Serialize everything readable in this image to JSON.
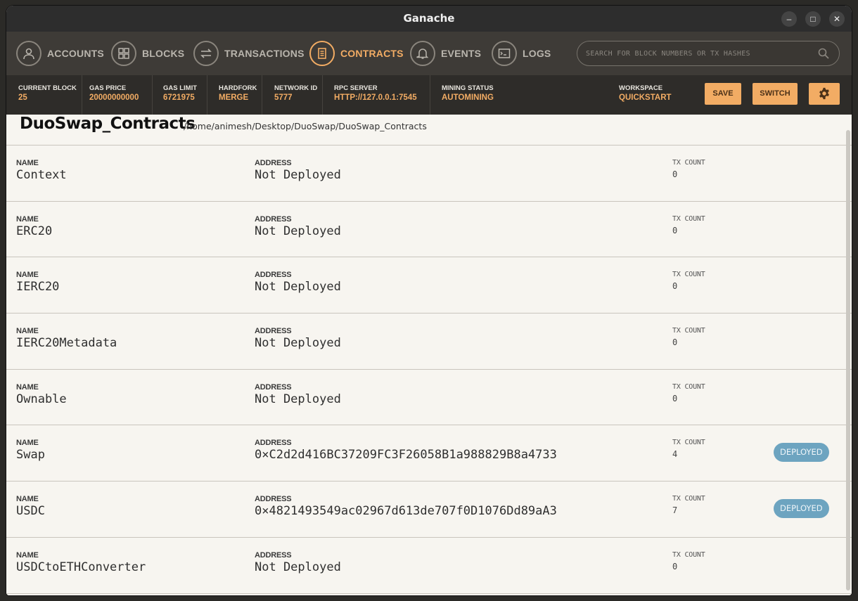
{
  "window": {
    "title": "Ganache"
  },
  "nav": {
    "items": [
      {
        "label": "ACCOUNTS",
        "icon": "account-icon"
      },
      {
        "label": "BLOCKS",
        "icon": "blocks-icon"
      },
      {
        "label": "TRANSACTIONS",
        "icon": "transactions-icon"
      },
      {
        "label": "CONTRACTS",
        "icon": "contracts-icon",
        "active": true
      },
      {
        "label": "EVENTS",
        "icon": "bell-icon"
      },
      {
        "label": "LOGS",
        "icon": "terminal-icon"
      }
    ],
    "search_placeholder": "SEARCH FOR BLOCK NUMBERS OR TX HASHES"
  },
  "status": {
    "current_block": {
      "label": "CURRENT BLOCK",
      "value": "25"
    },
    "gas_price": {
      "label": "GAS PRICE",
      "value": "20000000000"
    },
    "gas_limit": {
      "label": "GAS LIMIT",
      "value": "6721975"
    },
    "hardfork": {
      "label": "HARDFORK",
      "value": "MERGE"
    },
    "network_id": {
      "label": "NETWORK ID",
      "value": "5777"
    },
    "rpc_server": {
      "label": "RPC SERVER",
      "value": "HTTP://127.0.0.1:7545"
    },
    "mining_status": {
      "label": "MINING STATUS",
      "value": "AUTOMINING"
    },
    "workspace": {
      "label": "WORKSPACE",
      "value": "QUICKSTART"
    },
    "save_label": "SAVE",
    "switch_label": "SWITCH"
  },
  "project": {
    "name": "DuoSwap_Contracts",
    "path": "/home/animesh/Desktop/DuoSwap/DuoSwap_Contracts"
  },
  "columns": {
    "name": "NAME",
    "address": "ADDRESS",
    "tx_count": "TX COUNT"
  },
  "contracts": [
    {
      "name": "Context",
      "address": "Not Deployed",
      "tx_count": "0",
      "badge": ""
    },
    {
      "name": "ERC20",
      "address": "Not Deployed",
      "tx_count": "0",
      "badge": ""
    },
    {
      "name": "IERC20",
      "address": "Not Deployed",
      "tx_count": "0",
      "badge": ""
    },
    {
      "name": "IERC20Metadata",
      "address": "Not Deployed",
      "tx_count": "0",
      "badge": ""
    },
    {
      "name": "Ownable",
      "address": "Not Deployed",
      "tx_count": "0",
      "badge": ""
    },
    {
      "name": "Swap",
      "address": "0×C2d2d416BC37209FC3F26058B1a988829B8a4733",
      "tx_count": "4",
      "badge": "DEPLOYED"
    },
    {
      "name": "USDC",
      "address": "0×4821493549ac02967d613de707f0D1076Dd89aA3",
      "tx_count": "7",
      "badge": "DEPLOYED"
    },
    {
      "name": "USDCtoETHConverter",
      "address": "Not Deployed",
      "tx_count": "0",
      "badge": ""
    }
  ]
}
